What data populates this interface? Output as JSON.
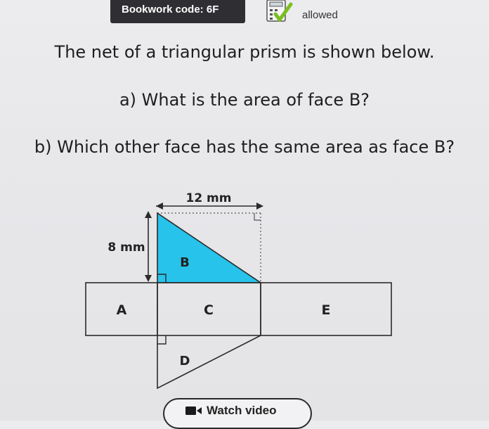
{
  "header": {
    "bookwork_label": "Bookwork code: 6F",
    "calculator_icon": "calculator-check-icon",
    "calculator_status": "allowed"
  },
  "question": {
    "intro": "The net of a triangular prism is shown below.",
    "part_a": "a) What is the area of face B?",
    "part_b": "b) Which other face has the same area as face B?"
  },
  "diagram": {
    "width_label": "12 mm",
    "height_label": "8 mm",
    "faces": {
      "a": "A",
      "b": "B",
      "c": "C",
      "d": "D",
      "e": "E"
    },
    "colors": {
      "face_b_fill": "#27c3ea",
      "outline": "#2b2b2b"
    }
  },
  "footer": {
    "watch_video_label": "Watch video",
    "video_icon": "video-camera-icon"
  }
}
